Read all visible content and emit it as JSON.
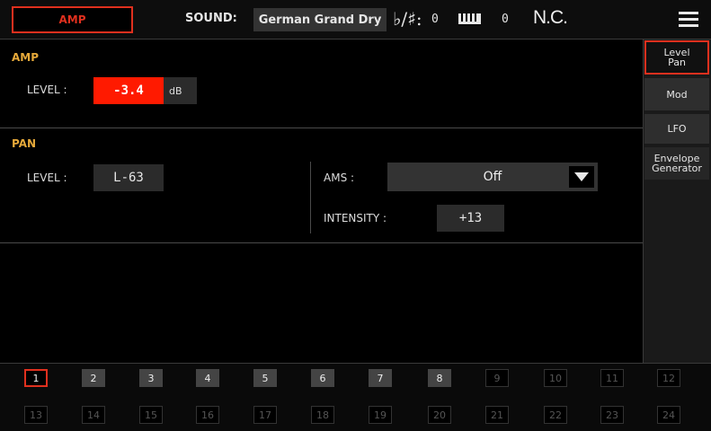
{
  "header": {
    "amp_tab_label": "AMP",
    "sound_label": "SOUND:",
    "sound_value": "German Grand Dry",
    "flat_sharp_symbol": "♭/♯:",
    "transpose_value": "0",
    "octave_value": "0",
    "chord_value": "N.C."
  },
  "amp": {
    "title": "AMP",
    "level_label": "LEVEL :",
    "level_value": "-3.4",
    "level_unit": "dB"
  },
  "pan": {
    "title": "PAN",
    "level_label": "LEVEL :",
    "level_value": "L-63",
    "ams_label": "AMS :",
    "ams_value": "Off",
    "intensity_label": "INTENSITY :",
    "intensity_value": "+13"
  },
  "tabs": [
    {
      "label": "Level Pan",
      "selected": true
    },
    {
      "label": "Mod"
    },
    {
      "label": "LFO"
    },
    {
      "label": "Envelope Generator"
    }
  ],
  "channels": {
    "selected": "1",
    "active": [
      "1",
      "2",
      "3",
      "4",
      "5",
      "6",
      "7",
      "8"
    ],
    "row1": [
      "1",
      "2",
      "3",
      "4",
      "5",
      "6",
      "7",
      "8",
      "9",
      "10",
      "11",
      "12"
    ],
    "row2": [
      "13",
      "14",
      "15",
      "16",
      "17",
      "18",
      "19",
      "20",
      "21",
      "22",
      "23",
      "24"
    ]
  },
  "colors": {
    "accent_red": "#e0301e",
    "highlight_value_bg": "#ff1a00",
    "section_title": "#e6a93a"
  }
}
